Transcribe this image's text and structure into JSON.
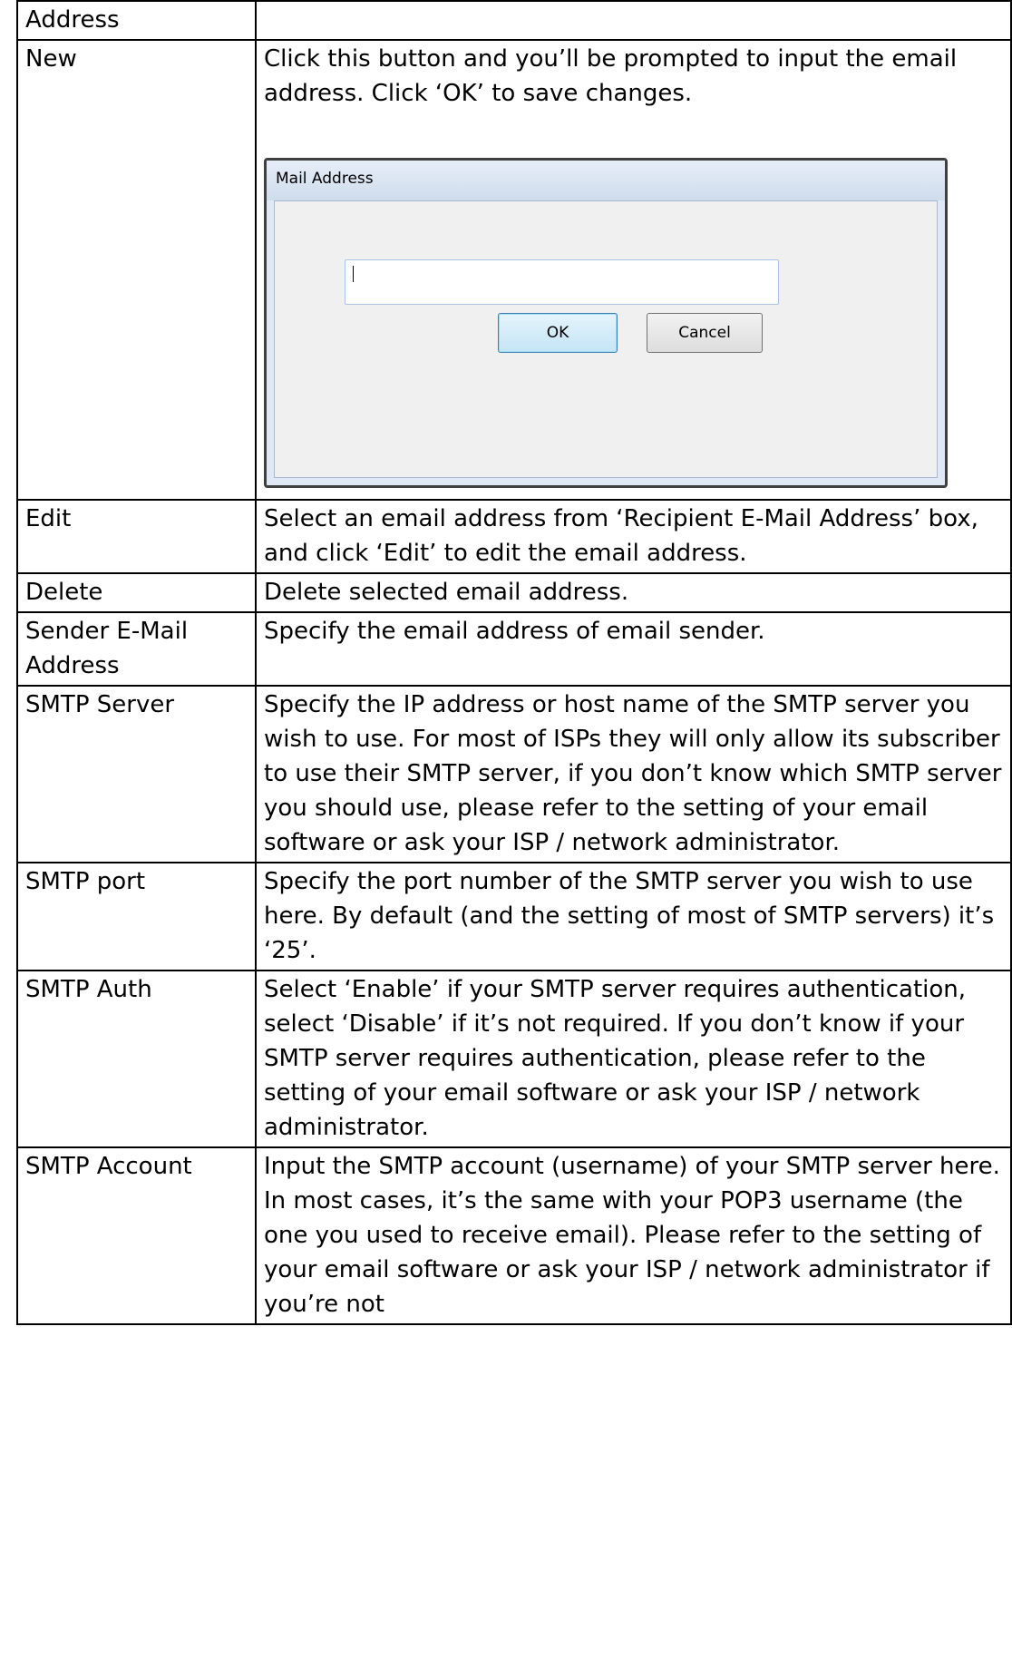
{
  "rows": [
    {
      "term": "Address",
      "desc": ""
    },
    {
      "term": "New",
      "desc": "Click this button and you’ll be prompted to input the email address. Click ‘OK’ to save changes."
    },
    {
      "term": "Edit",
      "desc": "Select an email address from ‘Recipient E-Mail Address’ box, and click ‘Edit’ to edit the email address."
    },
    {
      "term": "Delete",
      "desc": "Delete selected email address."
    },
    {
      "term": "Sender E-Mail Address",
      "desc": "Specify the email address of email sender."
    },
    {
      "term": "SMTP Server",
      "desc": "Specify the IP address or host name of the SMTP server you wish to use. For most of ISPs they will only allow its subscriber to use their SMTP server, if you don’t know which SMTP server you should use, please refer to the setting of your email software or ask your ISP / network administrator."
    },
    {
      "term": "SMTP port",
      "desc": "Specify the port number of the SMTP server you wish to use here. By default (and the setting of most of SMTP servers) it’s ‘25’."
    },
    {
      "term": "SMTP Auth",
      "desc": "Select ‘Enable’ if your SMTP server requires authentication, select ‘Disable’ if it’s not required. If you don’t know if your SMTP server requires authentication, please refer to the setting of your email software or ask your ISP / network administrator."
    },
    {
      "term": "SMTP Account",
      "desc": "Input the SMTP account (username) of your SMTP server here. In most cases, it’s the same with your POP3 username (the one you used to receive email). Please refer to the setting of your email software or ask your ISP / network administrator if you’re not"
    }
  ],
  "dialog": {
    "title": "Mail Address",
    "input_value": "",
    "ok_label": "OK",
    "cancel_label": "Cancel"
  }
}
